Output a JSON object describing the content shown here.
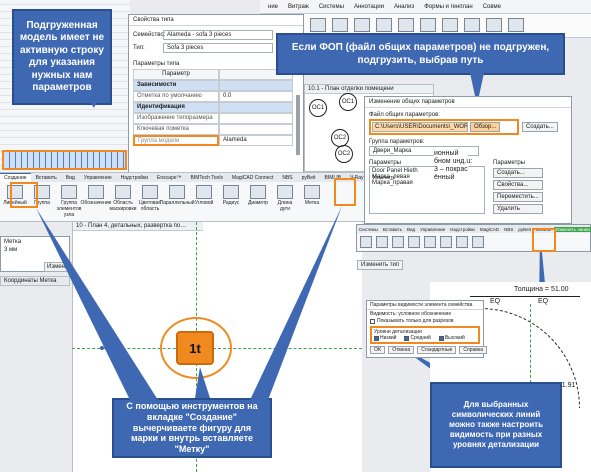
{
  "top_dialog": {
    "title": "Свойства типа",
    "family_label": "Семейство:",
    "family_value": "Alameda - sofa 3 pieces",
    "type_label": "Тип:",
    "type_value": "Sofa 3 pieces",
    "type_params_label": "Параметры типа",
    "col_param": "Параметр",
    "rows": [
      {
        "name": "Зависимости",
        "value": "",
        "group": true
      },
      {
        "name": "Отметка по умолчанию",
        "value": "0.0",
        "group": false
      },
      {
        "name": "Идентификация",
        "value": "",
        "group": true
      },
      {
        "name": "Изображение типоразмера",
        "value": "",
        "group": false
      },
      {
        "name": "Ключевая пометка",
        "value": "",
        "group": false
      },
      {
        "name": "Группа модели",
        "value": "Alameda",
        "group": false
      }
    ]
  },
  "top_menu": [
    "Аннотации",
    "Анализ",
    "Формы и генплан",
    "Совме"
  ],
  "top_menu_left": [
    "ние",
    "Витраж",
    "Системы"
  ],
  "callouts": {
    "loaded_model": "Подгруженная модель имеет не активную строку для указания нужных нам параметров",
    "fop": "Если ФОП (файл общих параметров) не подгружен, подгрузить, выбрав путь",
    "create_tools": "С помощью инструментов на вкладке \"Создание\" вычерчиваете фигуру для марки и внутрь вставляете \"Метку\"",
    "symbolic_lines": "Для выбранных символических линий можно также настроить видимость при разных уровнях детализации"
  },
  "plan_tab_title": "10.1 - План отделки помещени",
  "plan_labels": [
    "ОС1",
    "ОС2",
    "ОС1",
    "ОС2"
  ],
  "shared_params": {
    "title": "Изменение общих параметров",
    "file_label": "Файл общих параметров:",
    "file_path": "C:\\Users\\USER\\Documents\\_WORK\\2022",
    "browse": "Обзор...",
    "create": "Создать...",
    "group_label": "Группа параметров:",
    "group_value": "Двери_Марка",
    "params_label": "Параметры",
    "params": [
      "Door Panel Hieth",
      "Марка_левая",
      "Марка_правая"
    ],
    "params_right_label": "Параметры",
    "btn_create": "Создать...",
    "btn_properties": "Свойства...",
    "btn_move": "Переместить...",
    "btn_delete": "Удалить",
    "help_text": "ионный\nбном uнд.u:\n3 – покрас\nённый"
  },
  "ribbon": {
    "tabs": [
      "Создание",
      "Вставить",
      "Вид",
      "Управление",
      "Надстройки",
      "Enscape™",
      "BIMTech Tools",
      "MagiCAD Connect",
      "NBS",
      "pyBeit",
      "BIMLIB",
      "V-Ray",
      "Изменить"
    ],
    "buttons": [
      "Линейный",
      "Группа",
      "Группа элементов узла",
      "Обозначение",
      "Область маскировки",
      "Цветовая область",
      "Параллельный",
      "Угловой",
      "Радиус",
      "Диаметр",
      "Длина дуги",
      "Метка"
    ],
    "sections": [
      "Свойства",
      "Детализация",
      "Размер"
    ]
  },
  "plan_tab2": "10 - План 4, детальных, развертка по…",
  "properties_panel": {
    "title": "Метка",
    "subtitle": "3 мм",
    "edit_type": "Изменить тип",
    "header": "Коорди­на­ты Метка"
  },
  "tag_label": "1t",
  "visibility_dialog": {
    "title": "Параметры видимости элемента семейства",
    "show_in": "Видимость: условное обозначение",
    "check_plan": "Показывать только для разрезов",
    "detail_label": "Уровни детализации",
    "coarse": "Низкий",
    "medium": "Средний",
    "fine": "Высокий",
    "ok": "OK",
    "cancel": "Отмена",
    "defaults": "Стандартные",
    "help": "Справка"
  },
  "section_view": {
    "thickness": "Толщина = 51.00",
    "eq1": "EQ",
    "eq2": "EQ",
    "dim": "261.91"
  },
  "ribbon2_tabs": [
    "Системы",
    "Вставить",
    "Вид",
    "Управление",
    "Надстройки",
    "MagiCAD",
    "NBS",
    "pyBeit",
    "BIMLIB",
    "Изменить линии"
  ],
  "modify_dropdown": "Изменить тип",
  "colors": {
    "callout_blue": "#3f68b3",
    "orange": "#f08a1f",
    "grid_green": "#3ba34a"
  }
}
